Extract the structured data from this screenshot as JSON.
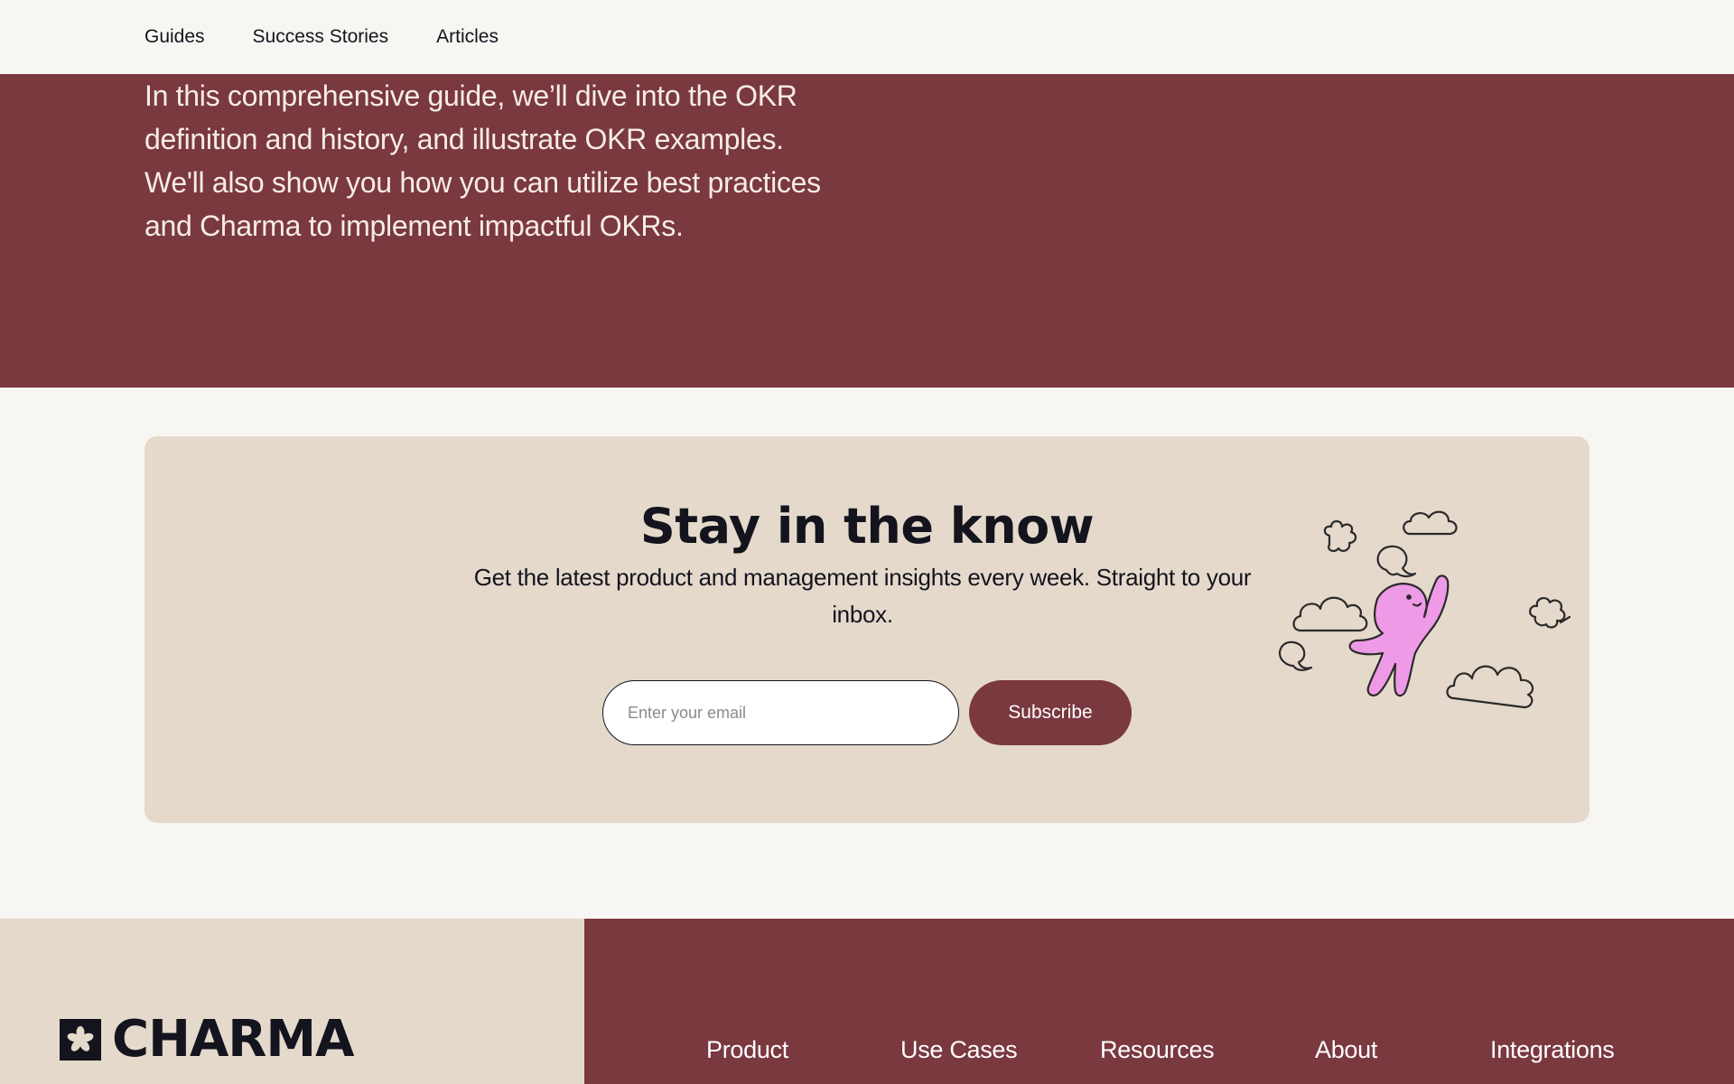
{
  "topnav": {
    "items": [
      {
        "label": "Guides"
      },
      {
        "label": "Success Stories"
      },
      {
        "label": "Articles"
      }
    ]
  },
  "hero": {
    "text": "In this comprehensive guide, we’ll dive into the OKR definition and history, and illustrate OKR examples. We'll also show you how you can utilize best practices and Charma to implement impactful OKRs."
  },
  "newsletter": {
    "title": "Stay in the know",
    "subtitle": "Get the latest product and management insights every week. Straight to your inbox.",
    "email_placeholder": "Enter your email",
    "button_label": "Subscribe"
  },
  "footer": {
    "logo_text": "CHARMA",
    "nav": [
      {
        "label": "Product"
      },
      {
        "label": "Use Cases"
      },
      {
        "label": "Resources"
      },
      {
        "label": "About"
      },
      {
        "label": "Integrations"
      }
    ]
  },
  "colors": {
    "brand": "#7a383f",
    "card": "#e4d9cb",
    "background": "#f8f6f2",
    "ink": "#14141e",
    "mascot": "#ee9ae6"
  }
}
